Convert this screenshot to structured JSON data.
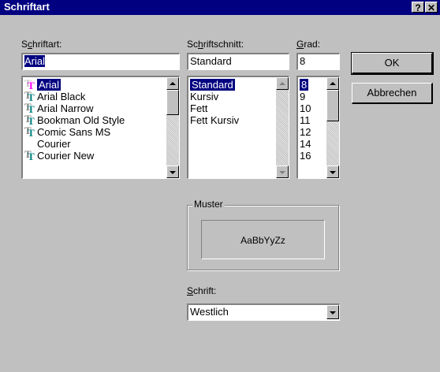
{
  "window": {
    "title": "Schriftart",
    "help_label": "?",
    "close_label": "✕"
  },
  "font": {
    "label_pre": "S",
    "label_ul": "c",
    "label_post": "hriftart:",
    "value": "Arial",
    "items": [
      {
        "label": "Arial",
        "icon": "truetype-icon"
      },
      {
        "label": "Arial Black",
        "icon": "truetype-icon"
      },
      {
        "label": "Arial Narrow",
        "icon": "truetype-icon"
      },
      {
        "label": "Bookman Old Style",
        "icon": "truetype-icon"
      },
      {
        "label": "Comic Sans MS",
        "icon": "truetype-icon"
      },
      {
        "label": "Courier",
        "icon": ""
      },
      {
        "label": "Courier New",
        "icon": "truetype-icon"
      }
    ]
  },
  "style": {
    "label_pre": "Sc",
    "label_ul": "h",
    "label_post": "riftschnitt:",
    "value": "Standard",
    "items": [
      "Standard",
      "Kursiv",
      "Fett",
      "Fett Kursiv"
    ]
  },
  "size": {
    "label_pre": "",
    "label_ul": "G",
    "label_post": "rad:",
    "value": "8",
    "items": [
      "8",
      "9",
      "10",
      "11",
      "12",
      "14",
      "16"
    ]
  },
  "buttons": {
    "ok": "OK",
    "cancel": "Abbrechen"
  },
  "sample": {
    "caption": "Muster",
    "text": "AaBbYyZz"
  },
  "script": {
    "label_pre": "",
    "label_ul": "S",
    "label_post": "chrift:",
    "value": "Westlich"
  },
  "colors": {
    "title_bar": "#000080",
    "face": "#c0c0c0",
    "selection": "#000080"
  }
}
